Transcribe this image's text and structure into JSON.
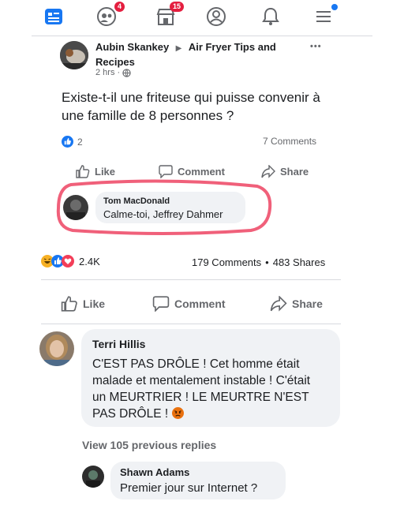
{
  "nav": {
    "home_icon": "news-feed-icon",
    "friends_badge": "4",
    "marketplace_badge": "15",
    "profile_icon": "profile-icon",
    "bell_icon": "bell-icon",
    "menu_icon": "menu-icon"
  },
  "post": {
    "author": "Aubin Skankey",
    "group_arrow": "▶",
    "group": "Air Fryer Tips and Recipes",
    "time": "2 hrs ·",
    "more": "•••",
    "text": "Existe-t-il une friteuse qui puisse convenir à une famille de 8 personnes ?",
    "reaction_count": "2",
    "comments_count": "7 Comments",
    "like_label": "Like",
    "comment_label": "Comment",
    "share_label": "Share"
  },
  "highlighted_comment": {
    "author": "Tom MacDonald",
    "text": "Calme-toi, Jeffrey Dahmer"
  },
  "outer_post": {
    "reaction_count": "2.4K",
    "comments_count": "179 Comments",
    "dot": "•",
    "shares_count": "483 Shares",
    "like_label": "Like",
    "comment_label": "Comment",
    "share_label": "Share"
  },
  "comments": [
    {
      "author": "Terri Hillis",
      "text": "C'EST PAS DRÔLE ! Cet homme était malade et mentalement instable ! C'était un MEURTRIER ! LE MEURTRE N'EST PAS DRÔLE !"
    }
  ],
  "view_more": "View 105 previous replies",
  "reply": {
    "author": "Shawn Adams",
    "text": "Premier jour sur Internet ?"
  },
  "colors": {
    "accent": "#1877f2",
    "badge": "#e41e3f",
    "highlight": "#f0607a"
  }
}
